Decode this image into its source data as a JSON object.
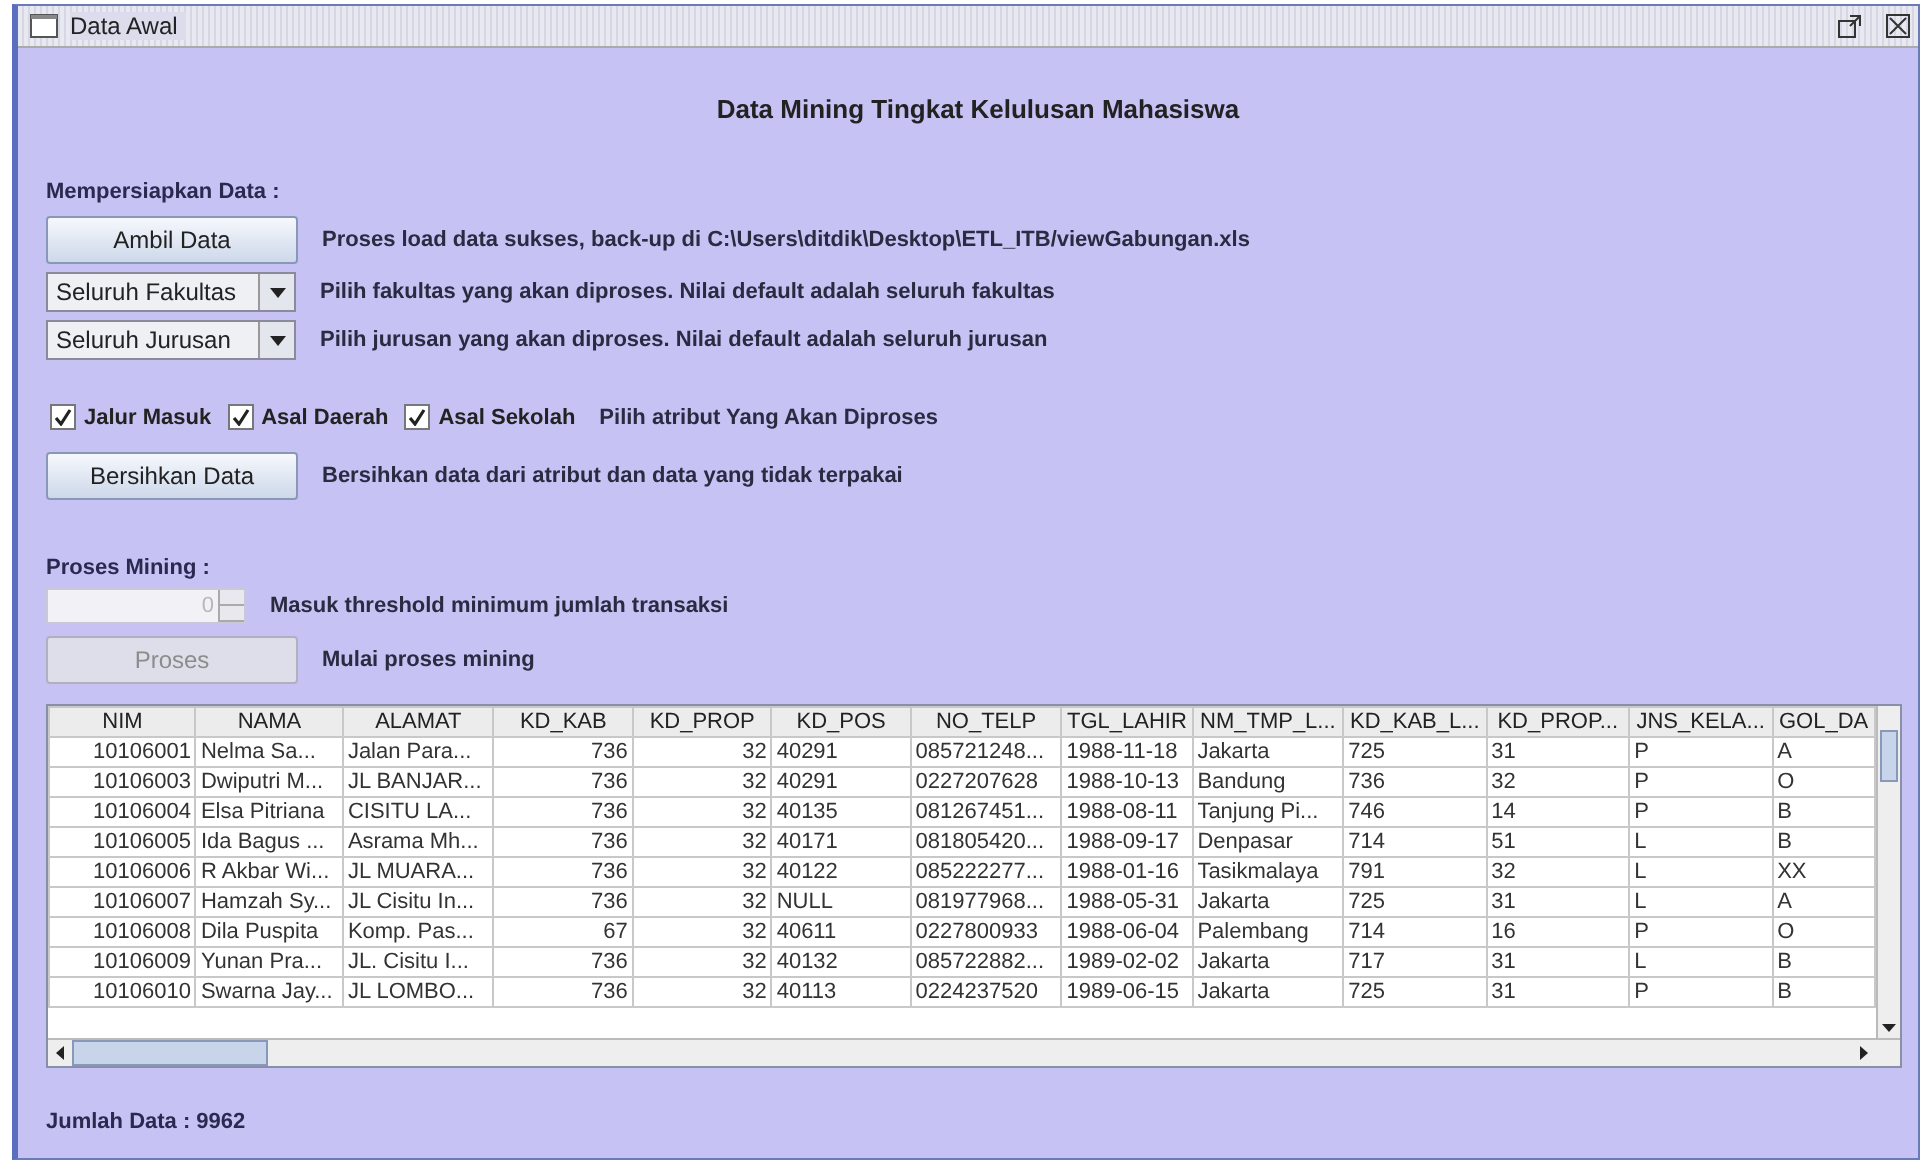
{
  "window": {
    "title": "Data Awal"
  },
  "heading": "Data Mining Tingkat Kelulusan Mahasiswa",
  "prepare": {
    "label": "Mempersiapkan Data :",
    "load": {
      "button": "Ambil Data",
      "message": "Proses load data sukses, back-up di C:\\Users\\ditdik\\Desktop\\ETL_ITB/viewGabungan.xls"
    },
    "dropdowns": [
      {
        "value": "Seluruh Fakultas",
        "hint": "Pilih fakultas yang akan diproses. Nilai default adalah seluruh fakultas"
      },
      {
        "value": "Seluruh Jurusan",
        "hint": "Pilih jurusan yang akan diproses. Nilai default adalah seluruh jurusan"
      }
    ],
    "attributes": [
      {
        "label": "Jalur Masuk",
        "checked": true
      },
      {
        "label": "Asal Daerah",
        "checked": true
      },
      {
        "label": "Asal Sekolah",
        "checked": true
      }
    ],
    "attributes_hint": "Pilih atribut Yang Akan Diproses",
    "clean": {
      "button": "Bersihkan Data",
      "message": "Bersihkan data dari atribut dan data yang tidak terpakai"
    }
  },
  "mining": {
    "label": "Proses Mining :",
    "threshold": {
      "value": "0",
      "disabled": true,
      "hint": "Masuk threshold minimum jumlah transaksi"
    },
    "run": {
      "button": "Proses",
      "disabled": true,
      "hint": "Mulai proses mining"
    }
  },
  "table": {
    "columns": [
      {
        "label": "NIM",
        "kind": "number"
      },
      {
        "label": "NAMA",
        "kind": "text"
      },
      {
        "label": "ALAMAT",
        "kind": "text"
      },
      {
        "label": "KD_KAB",
        "kind": "number"
      },
      {
        "label": "KD_PROP",
        "kind": "number"
      },
      {
        "label": "KD_POS",
        "kind": "text"
      },
      {
        "label": "NO_TELP",
        "kind": "text"
      },
      {
        "label": "TGL_LAHIR",
        "kind": "text"
      },
      {
        "label": "NM_TMP_L...",
        "kind": "text"
      },
      {
        "label": "KD_KAB_L...",
        "kind": "text"
      },
      {
        "label": "KD_PROP...",
        "kind": "text"
      },
      {
        "label": "JNS_KELA...",
        "kind": "text"
      },
      {
        "label": "GOL_DA",
        "kind": "text"
      }
    ],
    "rows": [
      [
        "10106001",
        "Nelma Sa...",
        "Jalan Para...",
        "736",
        "32",
        "40291",
        "085721248...",
        "1988-11-18",
        "Jakarta",
        "725",
        "31",
        "P",
        "A"
      ],
      [
        "10106003",
        "Dwiputri M...",
        "JL BANJAR...",
        "736",
        "32",
        "40291",
        "0227207628",
        "1988-10-13",
        "Bandung",
        "736",
        "32",
        "P",
        "O"
      ],
      [
        "10106004",
        "Elsa Pitriana",
        "CISITU LA...",
        "736",
        "32",
        "40135",
        "081267451...",
        "1988-08-11",
        "Tanjung Pi...",
        "746",
        "14",
        "P",
        "B"
      ],
      [
        "10106005",
        "Ida Bagus ...",
        "Asrama Mh...",
        "736",
        "32",
        "40171",
        "081805420...",
        "1988-09-17",
        "Denpasar",
        "714",
        "51",
        "L",
        "B"
      ],
      [
        "10106006",
        "R Akbar Wi...",
        "JL MUARA...",
        "736",
        "32",
        "40122",
        "085222277...",
        "1988-01-16",
        "Tasikmalaya",
        "791",
        "32",
        "L",
        "XX"
      ],
      [
        "10106007",
        "Hamzah Sy...",
        "JL Cisitu In...",
        "736",
        "32",
        "NULL",
        "081977968...",
        "1988-05-31",
        "Jakarta",
        "725",
        "31",
        "L",
        "A"
      ],
      [
        "10106008",
        "Dila Puspita",
        "Komp. Pas...",
        "67",
        "32",
        "40611",
        "0227800933",
        "1988-06-04",
        "Palembang",
        "714",
        "16",
        "P",
        "O"
      ],
      [
        "10106009",
        "Yunan Pra...",
        "JL. Cisitu I...",
        "736",
        "32",
        "40132",
        "085722882...",
        "1989-02-02",
        "Jakarta",
        "717",
        "31",
        "L",
        "B"
      ],
      [
        "10106010",
        "Swarna Jay...",
        "JL LOMBO...",
        "736",
        "32",
        "40113",
        "0224237520",
        "1989-06-15",
        "Jakarta",
        "725",
        "31",
        "P",
        "B"
      ]
    ]
  },
  "status": "Jumlah Data : 9962"
}
